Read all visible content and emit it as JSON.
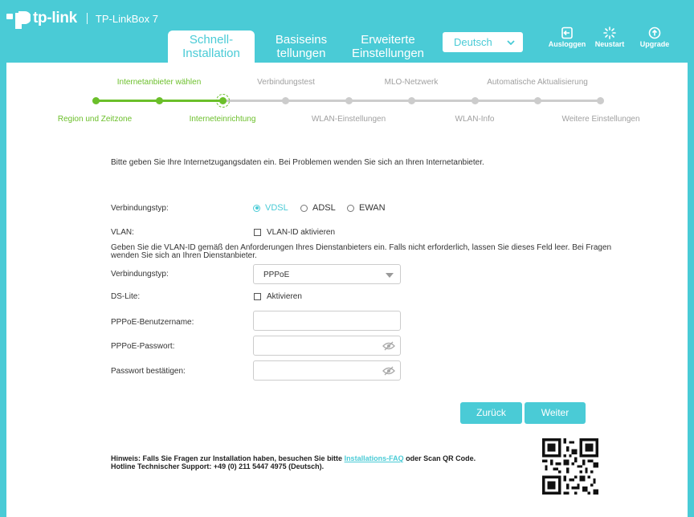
{
  "header": {
    "product": "TP-LinkBox 7",
    "tabs": [
      {
        "line1": "Schnell-",
        "line2": "Installation"
      },
      {
        "line1": "Basiseins",
        "line2": "tellungen"
      },
      {
        "line1": "Erweiterte",
        "line2": "Einstellungen"
      }
    ],
    "language": "Deutsch",
    "actions": {
      "logout": "Ausloggen",
      "restart": "Neustart",
      "upgrade": "Upgrade"
    }
  },
  "steps": {
    "top": [
      "Internetanbieter wählen",
      "Verbindungstest",
      "MLO-Netzwerk",
      "Automatische Aktualisierung"
    ],
    "bottom": [
      "Region und Zeitzone",
      "Interneteinrichtung",
      "WLAN-Einstellungen",
      "WLAN-Info",
      "Weitere Einstellungen"
    ]
  },
  "form": {
    "intro": "Bitte geben Sie Ihre Internetzugangsdaten ein. Bei Problemen wenden Sie sich an Ihren Internetanbieter.",
    "connection_type_label": "Verbindungstyp:",
    "connection_options": [
      "VDSL",
      "ADSL",
      "EWAN"
    ],
    "vlan_label": "VLAN:",
    "vlan_checkbox": "VLAN-ID aktivieren",
    "vlan_hint": "Geben Sie die VLAN-ID gemäß den Anforderungen Ihres Dienstanbieters ein. Falls nicht erforderlich, lassen Sie dieses Feld leer.  Bei Fragen wenden Sie sich an Ihren Dienstanbieter.",
    "protocol_label": "Verbindungstyp:",
    "protocol_value": "PPPoE",
    "dslite_label": "DS-Lite:",
    "dslite_checkbox": "Aktivieren",
    "username_label": "PPPoE-Benutzername:",
    "password_label": "PPPoE-Passwort:",
    "confirm_label": "Passwort bestätigen:",
    "back_button": "Zurück",
    "next_button": "Weiter"
  },
  "footer": {
    "note_prefix": "Hinweis: Falls Sie Fragen zur Installation haben, besuchen Sie bitte ",
    "note_link": "Installations-FAQ",
    "note_suffix": " oder Scan QR Code.",
    "hotline": "Hotline Technischer Support: +49 (0) 211 5447 4975 (Deutsch)."
  },
  "colors": {
    "accent": "#4acbd6",
    "progress": "#6bbf2a",
    "inactive": "#cccccc"
  }
}
